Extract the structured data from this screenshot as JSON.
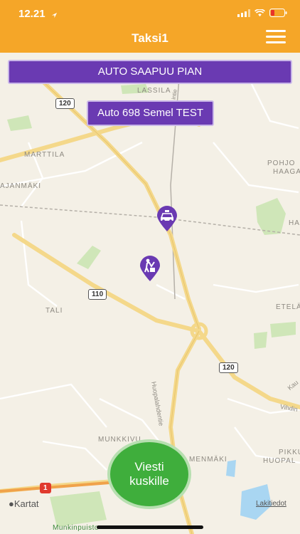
{
  "status": {
    "time": "12.21"
  },
  "nav": {
    "title": "Taksi1",
    "menu_icon": "hamburger-menu-icon"
  },
  "banners": {
    "arrival": "AUTO SAAPUU PIAN",
    "car": "Auto 698 Semel TEST"
  },
  "map": {
    "labels": {
      "lassila": "LASSILA",
      "marttila": "MARTTILA",
      "pohjois": "POHJO",
      "haaga": "HAAGA",
      "kajanmaki": "AJANMÄKI",
      "ha": "HA",
      "tali": "TALI",
      "etela": "ETELÄ",
      "munkkiv": "MUNKKIVU",
      "menmaki": "MENMÄKI",
      "pikku": "PIKKU",
      "huopa": "HUOPAL",
      "huopalahdentie": "Huopalahdentie",
      "vihdin": "Vihdin",
      "kau": "Kau",
      "veie": "intie"
    },
    "shields": {
      "r120a": "120",
      "r110": "110",
      "r120b": "120",
      "r1": "1"
    }
  },
  "message_button": {
    "line1": "Viesti",
    "line2": "kuskille"
  },
  "footer": {
    "maps_brand": "Kartat",
    "legal": "Lakitiedot",
    "poi": "Munkinpuisto"
  },
  "colors": {
    "accent": "#f5a628",
    "banner": "#6a3ab2",
    "message": "#3fae3c"
  }
}
